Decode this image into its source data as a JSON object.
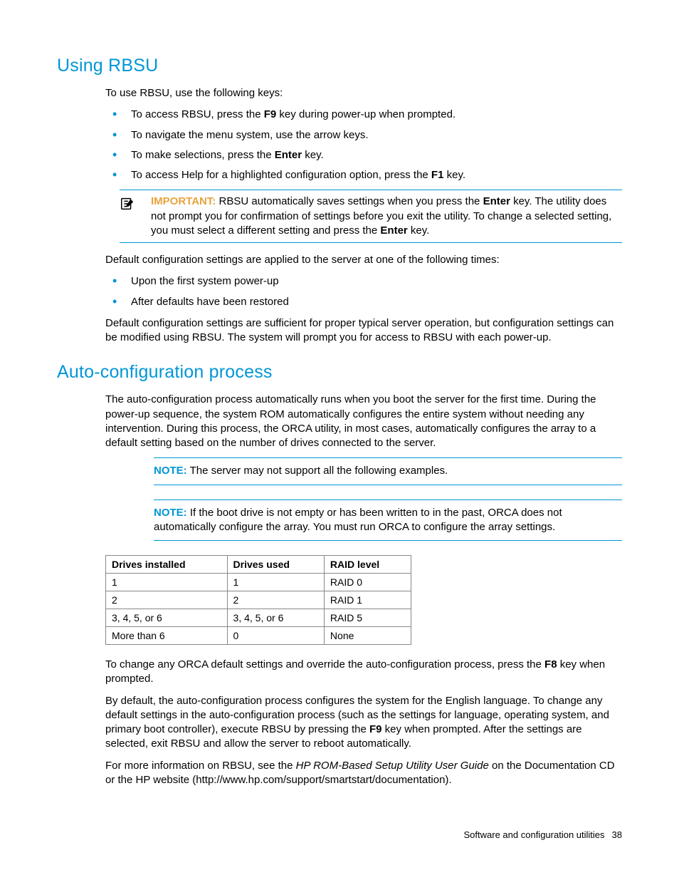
{
  "section1": {
    "title": "Using RBSU",
    "intro": "To use RBSU, use the following keys:",
    "bullets1": [
      {
        "pre": "To access RBSU, press the ",
        "b": "F9",
        "post": " key during power-up when prompted."
      },
      {
        "pre": "To navigate the menu system, use the arrow keys.",
        "b": "",
        "post": ""
      },
      {
        "pre": "To make selections, press the ",
        "b": "Enter",
        "post": " key."
      },
      {
        "pre": "To access Help for a highlighted configuration option, press the ",
        "b": "F1",
        "post": " key."
      }
    ],
    "important": {
      "label": "IMPORTANT:",
      "t1": "  RBSU automatically saves settings when you press the ",
      "b1": "Enter",
      "t2": " key. The utility does not prompt you for confirmation of settings before you exit the utility. To change a selected setting, you must select a different setting and press the ",
      "b2": "Enter",
      "t3": " key."
    },
    "p2": "Default configuration settings are applied to the server at one of the following times:",
    "bullets2": [
      "Upon the first system power-up",
      "After defaults have been restored"
    ],
    "p3": "Default configuration settings are sufficient for proper typical server operation, but configuration settings can be modified using RBSU. The system will prompt you for access to RBSU with each power-up."
  },
  "section2": {
    "title": "Auto-configuration process",
    "p1": "The auto-configuration process automatically runs when you boot the server for the first time. During the power-up sequence, the system ROM automatically configures the entire system without needing any intervention. During this process, the ORCA utility, in most cases, automatically configures the array to a default setting based on the number of drives connected to the server.",
    "note1": {
      "label": "NOTE:",
      "text": "  The server may not support all the following examples."
    },
    "note2": {
      "label": "NOTE:",
      "text": "  If the boot drive is not empty or has been written to in the past, ORCA does not automatically configure the array. You must run ORCA to configure the array settings."
    },
    "table": {
      "headers": [
        "Drives installed",
        "Drives used",
        "RAID level"
      ],
      "rows": [
        [
          "1",
          "1",
          "RAID 0"
        ],
        [
          "2",
          "2",
          "RAID 1"
        ],
        [
          "3, 4, 5, or 6",
          "3, 4, 5, or 6",
          "RAID 5"
        ],
        [
          "More than 6",
          "0",
          "None"
        ]
      ]
    },
    "p2": {
      "t1": "To change any ORCA default settings and override the auto-configuration process, press the ",
      "b": "F8",
      "t2": " key when prompted."
    },
    "p3": {
      "t1": "By default, the auto-configuration process configures the system for the English language. To change any default settings in the auto-configuration process (such as the settings for language, operating system, and primary boot controller), execute RBSU by pressing the ",
      "b": "F9",
      "t2": " key when prompted. After the settings are selected, exit RBSU and allow the server to reboot automatically."
    },
    "p4": {
      "t1": "For more information on RBSU, see the ",
      "i": "HP ROM-Based Setup Utility User Guide",
      "t2": " on the Documentation CD or the HP website (http://www.hp.com/support/smartstart/documentation)."
    }
  },
  "footer": {
    "text": "Software and configuration utilities",
    "page": "38"
  }
}
